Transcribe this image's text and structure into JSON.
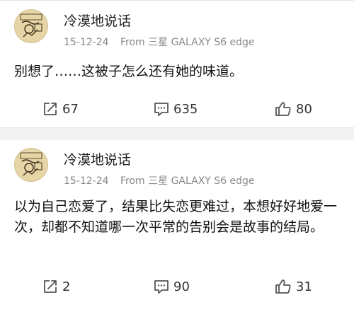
{
  "posts": [
    {
      "username": "冷漠地说话",
      "date": "15-12-24",
      "source": "From 三星 GALAXY S6 edge",
      "text": "别想了……这被子怎么还有她的味道。",
      "reposts": "67",
      "comments": "635",
      "likes": "80"
    },
    {
      "username": "冷漠地说话",
      "date": "15-12-24",
      "source": "From 三星 GALAXY S6 edge",
      "text": "以为自己恋爱了，结果比失恋更难过，本想好好地爱一次，却都不知道哪一次平常的告别会是故事的结局。",
      "reposts": "2",
      "comments": "90",
      "likes": "31"
    }
  ],
  "icons": {
    "repost": "repost-icon",
    "comment": "comment-icon",
    "like": "thumbs-up-icon"
  },
  "colors": {
    "text": "#222222",
    "meta": "#888888",
    "icon": "#555555",
    "divider": "#f2f2f2"
  }
}
